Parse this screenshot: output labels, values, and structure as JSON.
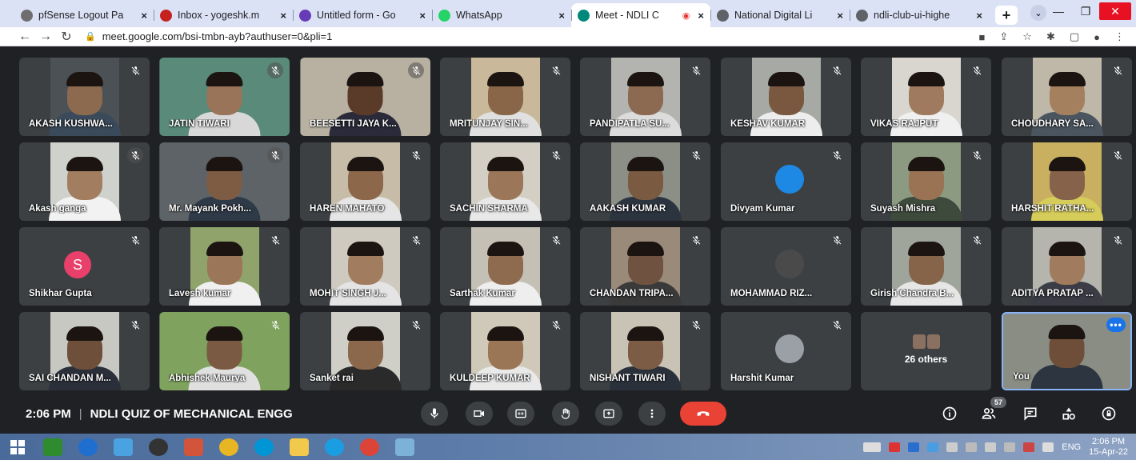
{
  "browser": {
    "tabs": [
      {
        "title": "pfSense Logout Pa",
        "icon": "pfsense-icon",
        "color": "#6e6e6e"
      },
      {
        "title": "Inbox - yogeshk.m",
        "icon": "gmail-icon",
        "color": "#c5221f"
      },
      {
        "title": "Untitled form - Go",
        "icon": "forms-icon",
        "color": "#673ab7"
      },
      {
        "title": "WhatsApp",
        "icon": "whatsapp-icon",
        "color": "#25d366"
      },
      {
        "title": "Meet - NDLI C",
        "icon": "meet-icon",
        "color": "#00897b",
        "active": true
      },
      {
        "title": "National Digital Li",
        "icon": "globe-icon",
        "color": "#5f6368"
      },
      {
        "title": "ndli-club-ui-highe",
        "icon": "globe-icon",
        "color": "#5f6368"
      }
    ],
    "tab_close": "×",
    "new_tab": "+",
    "url": "meet.google.com/bsi-tmbn-ayb?authuser=0&pli=1"
  },
  "participants": [
    {
      "name": "AKASH KUSHWA...",
      "kind": "video",
      "skin": "#8b6a50",
      "shirt": "#3a4a5a",
      "bg": "#4b5154"
    },
    {
      "name": "JATIN TIWARI",
      "kind": "video",
      "skin": "#9a7458",
      "shirt": "#d8d8d8",
      "bg": "#5a8a7a",
      "wide": true
    },
    {
      "name": "BEESETTI JAYA K...",
      "kind": "video",
      "skin": "#5a3a28",
      "shirt": "#2a2a3a",
      "bg": "#b8b0a0",
      "wide": true
    },
    {
      "name": "MRITUNJAY SIN...",
      "kind": "video",
      "skin": "#8a6648",
      "shirt": "#e0e0e0",
      "bg": "#c9b89a"
    },
    {
      "name": "PANDIPATLA SU...",
      "kind": "video",
      "skin": "#8c6a52",
      "shirt": "#dcdcdc",
      "bg": "#b3b3b0"
    },
    {
      "name": "KESHAV KUMAR",
      "kind": "video",
      "skin": "#7a5840",
      "shirt": "#ededed",
      "bg": "#a7a9a4"
    },
    {
      "name": "VIKAS RAJPUT",
      "kind": "video",
      "skin": "#a07a5e",
      "shirt": "#f0f0f0",
      "bg": "#d9d6cf"
    },
    {
      "name": "CHOUDHARY SA...",
      "kind": "video",
      "skin": "#a5805f",
      "shirt": "#4a5560",
      "bg": "#bfb8a8"
    },
    {
      "name": "Akash ganga",
      "kind": "video",
      "skin": "#a37d60",
      "shirt": "#f2f2f2",
      "bg": "#cfd2cc"
    },
    {
      "name": "Mr. Mayank Pokh...",
      "kind": "video",
      "skin": "#7e5c44",
      "shirt": "#2f3a48",
      "bg": "#5d6366",
      "wide": true
    },
    {
      "name": "HAREN MAHATO",
      "kind": "video",
      "skin": "#8d6749",
      "shirt": "#e5e5e5",
      "bg": "#c6bca8"
    },
    {
      "name": "SACHIN SHARMA",
      "kind": "video",
      "skin": "#9b7658",
      "shirt": "#e8e8e8",
      "bg": "#d3cfc4"
    },
    {
      "name": "AAKASH KUMAR",
      "kind": "video",
      "skin": "#7b5a42",
      "shirt": "#2c3440",
      "bg": "#8c8f86"
    },
    {
      "name": "Divyam Kumar",
      "kind": "avatar-img"
    },
    {
      "name": "Suyash Mishra",
      "kind": "video",
      "skin": "#9a7254",
      "shirt": "#3d4a3c",
      "bg": "#8b9a80"
    },
    {
      "name": "HARSHIT RATHA...",
      "kind": "video",
      "skin": "#86624a",
      "shirt": "#d6cc5a",
      "bg": "#c8b060"
    },
    {
      "name": "Shikhar Gupta",
      "kind": "avatar-letter",
      "letter": "S"
    },
    {
      "name": "Lavesh kumar",
      "kind": "video",
      "skin": "#9b7658",
      "shirt": "#f0f0f0",
      "bg": "#8fa36b"
    },
    {
      "name": "MOHIT SINGH J...",
      "kind": "video",
      "skin": "#a27c5f",
      "shirt": "#e4e4e4",
      "bg": "#cfcac0"
    },
    {
      "name": "Sarthak Kumar",
      "kind": "video",
      "skin": "#8e6a4e",
      "shirt": "#eeeeee",
      "bg": "#c5c0b5"
    },
    {
      "name": "CHANDAN TRIPA...",
      "kind": "video",
      "skin": "#6f5240",
      "shirt": "#3a3a3a",
      "bg": "#9a8a7a"
    },
    {
      "name": "MOHAMMAD RIZ...",
      "kind": "avatar-img"
    },
    {
      "name": "Girish Chandra B...",
      "kind": "video",
      "skin": "#86644a",
      "shirt": "#e6e6e6",
      "bg": "#a0a59c"
    },
    {
      "name": "ADITYA PRATAP ...",
      "kind": "video",
      "skin": "#a07b5d",
      "shirt": "#3c3c46",
      "bg": "#b5b5ae"
    },
    {
      "name": "SAI CHANDAN M...",
      "kind": "video",
      "skin": "#6e4f3a",
      "shirt": "#2a2f3a",
      "bg": "#c8c8c2"
    },
    {
      "name": "Abhishek Maurya",
      "kind": "video",
      "skin": "#7a5a42",
      "shirt": "#e0e0e0",
      "bg": "#7fa35e",
      "wide": true
    },
    {
      "name": "Sanket rai",
      "kind": "video",
      "skin": "#8b684c",
      "shirt": "#2a2a2a",
      "bg": "#cfcfc8"
    },
    {
      "name": "KULDEEP KUMAR",
      "kind": "video",
      "skin": "#9a7556",
      "shirt": "#e9e9e9",
      "bg": "#d0c8b8"
    },
    {
      "name": "NISHANT TIWARI",
      "kind": "video",
      "skin": "#7c5c44",
      "shirt": "#2b313b",
      "bg": "#c9c3b6"
    },
    {
      "name": "Harshit Kumar",
      "kind": "avatar-img"
    },
    {
      "name": "26 others",
      "kind": "others"
    },
    {
      "name": "You",
      "kind": "self",
      "skin": "#6e4e38",
      "shirt": "#2c3540",
      "bg": "#8a8d84"
    }
  ],
  "meeting": {
    "time": "2:06 PM",
    "separator": "|",
    "title": "NDLI QUIZ OF MECHANICAL ENGG",
    "participant_count": "57",
    "more_options": "•••"
  },
  "taskbar": {
    "language": "ENG",
    "time": "2:06 PM",
    "date": "15-Apr-22"
  },
  "colors": {
    "meet_bg": "#202124",
    "tile_bg": "#3c4043",
    "leave_red": "#ea4335",
    "self_border": "#8ab4f8",
    "avatar_pink": "#e8406a"
  }
}
